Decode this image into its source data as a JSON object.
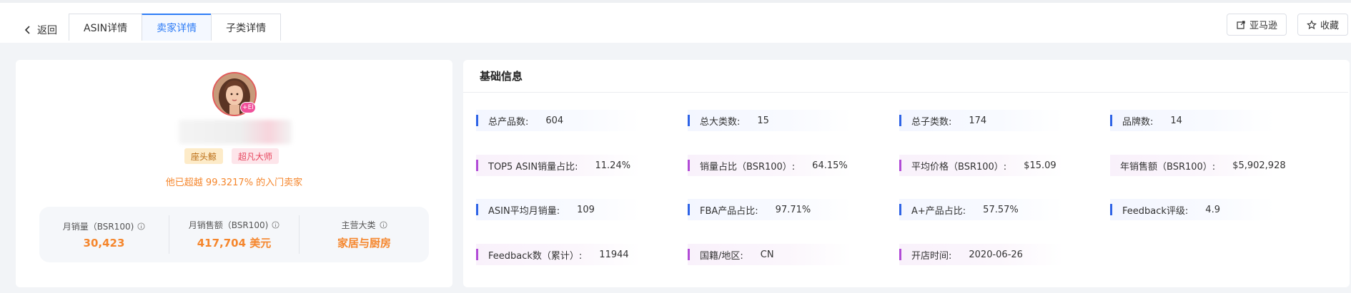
{
  "header": {
    "back_label": "返回",
    "tabs": [
      {
        "label": "ASIN详情",
        "active": false
      },
      {
        "label": "卖家详情",
        "active": true
      },
      {
        "label": "子类详情",
        "active": false
      }
    ],
    "amazon_button": "亚马逊",
    "favorite_button": "收藏"
  },
  "seller": {
    "avatar_badge": "+EI",
    "tags": [
      "座头鲸",
      "超凡大师"
    ],
    "exceed_text": "他已超越 99.3217% 的入门卖家",
    "stats": [
      {
        "label": "月销量（BSR100)",
        "value": "30,423"
      },
      {
        "label": "月销售额（BSR100)",
        "value": "417,704 美元"
      },
      {
        "label": "主营大类",
        "value": "家居与厨房"
      }
    ]
  },
  "basic_info": {
    "title": "基础信息",
    "rows": [
      [
        {
          "label": "总产品数:",
          "value": "604"
        },
        {
          "label": "总大类数:",
          "value": "15"
        },
        {
          "label": "总子类数:",
          "value": "174"
        },
        {
          "label": "品牌数:",
          "value": "14"
        }
      ],
      [
        {
          "label": "TOP5 ASIN销量占比:",
          "value": "11.24%"
        },
        {
          "label": "销量占比（BSR100）:",
          "value": "64.15%"
        },
        {
          "label": "平均价格（BSR100）:",
          "value": "$15.09"
        },
        {
          "label": "年销售额（BSR100）:",
          "value": "$5,902,928"
        }
      ],
      [
        {
          "label": "ASIN平均月销量:",
          "value": "109"
        },
        {
          "label": "FBA产品占比:",
          "value": "97.71%"
        },
        {
          "label": "A+产品占比:",
          "value": "57.57%"
        },
        {
          "label": "Feedback评级:",
          "value": "4.9"
        }
      ],
      [
        {
          "label": "Feedback数（累计）:",
          "value": "11944"
        },
        {
          "label": "国籍/地区:",
          "value": "CN"
        },
        {
          "label": "开店时间:",
          "value": "2020-06-26"
        }
      ]
    ]
  },
  "colors": {
    "accent_blue": "#2e7cf6",
    "highlight_orange": "#f5862c",
    "bar_blue": "#2e63e6",
    "bar_purple": "#b14bd6"
  }
}
